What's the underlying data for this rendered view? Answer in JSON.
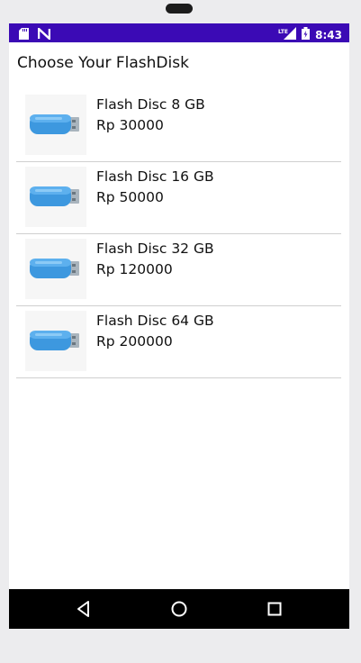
{
  "status_bar": {
    "time": "8:43",
    "left_icons": [
      "sd-card-icon",
      "n-icon"
    ],
    "right_icons": [
      "lte-signal-icon",
      "battery-icon"
    ],
    "lte_label": "LTE"
  },
  "header": {
    "title": "Choose Your FlashDisk"
  },
  "products": [
    {
      "name": "Flash Disc 8 GB",
      "price": "Rp 30000",
      "icon": "usb-flash-drive-icon"
    },
    {
      "name": "Flash Disc 16 GB",
      "price": "Rp 50000",
      "icon": "usb-flash-drive-icon"
    },
    {
      "name": "Flash Disc 32 GB",
      "price": "Rp 120000",
      "icon": "usb-flash-drive-icon"
    },
    {
      "name": "Flash Disc 64 GB",
      "price": "Rp 200000",
      "icon": "usb-flash-drive-icon"
    }
  ],
  "nav_bar": {
    "buttons": [
      "back-icon",
      "home-icon",
      "recents-icon"
    ]
  },
  "colors": {
    "status_bar": "#3b0ab5",
    "usb_body": "#3d98df",
    "usb_connector": "#a9b4bd"
  }
}
